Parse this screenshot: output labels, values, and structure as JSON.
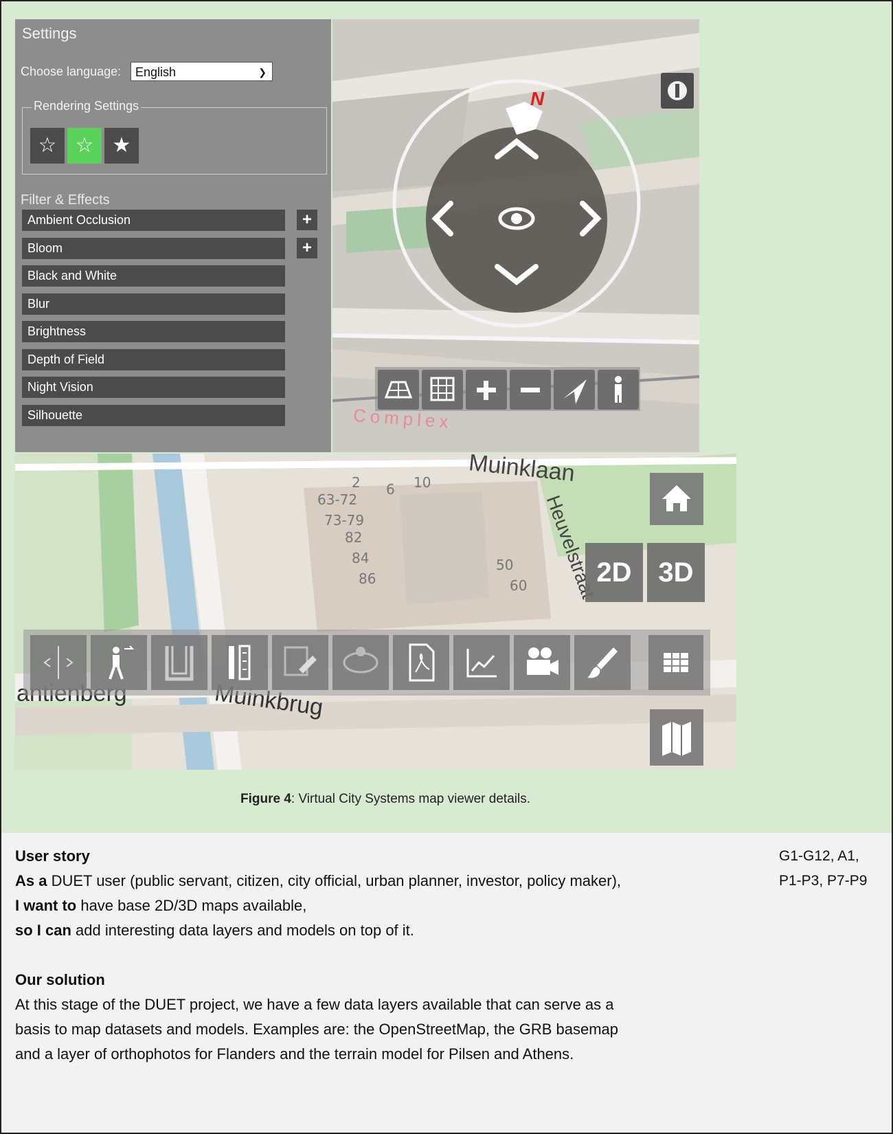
{
  "settings": {
    "title": "Settings",
    "language_label": "Choose language:",
    "language_value": "English",
    "rendering_legend": "Rendering Settings",
    "quality_buttons": [
      "outline-star-icon",
      "half-star-icon",
      "solid-star-icon"
    ],
    "quality_selected": 1,
    "filters_label": "Filter & Effects",
    "filters": [
      "Ambient Occlusion",
      "Bloom",
      "Black and White",
      "Blur",
      "Brightness",
      "Depth of Field",
      "Night Vision",
      "Silhouette"
    ],
    "filters_with_options": [
      "Ambient Occlusion",
      "Bloom"
    ],
    "selected_color": "#5ad15a"
  },
  "map3d": {
    "compass_label": "N",
    "street_text": "Complex",
    "nav_buttons": [
      "arrow-up-icon",
      "arrow-left-icon",
      "eye-icon",
      "arrow-right-icon",
      "arrow-down-icon"
    ],
    "bottom_tools": [
      "tilt-grid-icon",
      "grid-icon",
      "zoom-in-icon",
      "zoom-out-icon",
      "locate-icon",
      "pedestrian-icon"
    ],
    "overlay_button": "info-toggle-icon"
  },
  "map2d": {
    "street_labels": [
      "Muinklaan",
      "Heuvelstraat",
      "antienberg",
      "Muinkbrug"
    ],
    "house_numbers": [
      "2",
      "6",
      "10",
      "63-72",
      "73-79",
      "82",
      "84",
      "86",
      "50",
      "60"
    ],
    "view_buttons": [
      "2D",
      "3D"
    ],
    "tools": [
      "swipe-icon",
      "walk-icon",
      "cross-section-icon",
      "measure-icon",
      "drawing-icon",
      "viewshed-icon",
      "pdf-icon",
      "chart-icon",
      "camera-icon",
      "brush-icon",
      "grid-icon"
    ],
    "side_buttons": [
      "home-icon",
      "map-icon"
    ]
  },
  "caption": {
    "label": "Figure 4",
    "text": ": Virtual City Systems map viewer details."
  },
  "story": {
    "heading": "User story",
    "as_a": "As a",
    "as_a_text": " DUET user (public servant, citizen, city official, urban planner, investor, policy maker),",
    "i_want": "I want to",
    "i_want_text": " have base 2D/3D maps available,",
    "so_i_can": "so I can",
    "so_i_can_text": " add interesting data layers and models on top of it.",
    "solution_heading": "Our solution",
    "solution_line1": "At this stage of the DUET project, we have a few data layers available that can serve as a",
    "solution_line2": "basis to map datasets and models. Examples are: the OpenStreetMap, the GRB basemap",
    "solution_line3": "and a layer of orthophotos for Flanders and the terrain model for Pilsen and Athens."
  },
  "references": {
    "line1": "G1-G12, A1,",
    "line2": "P1-P3, P7-P9"
  }
}
